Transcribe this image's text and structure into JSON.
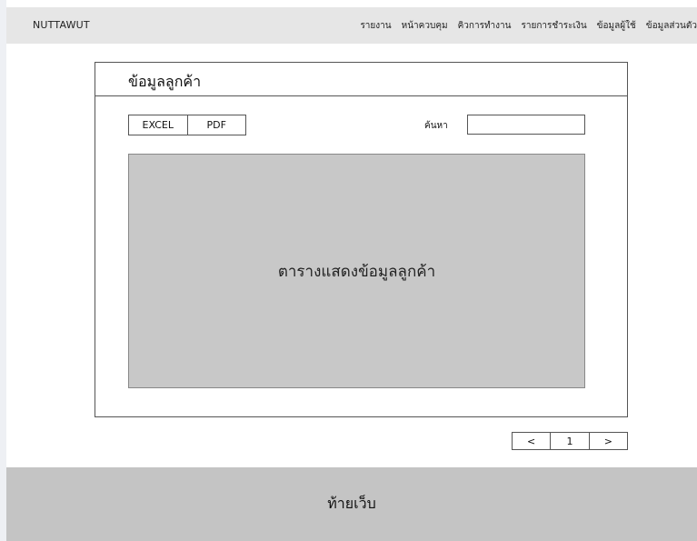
{
  "navbar": {
    "brand": "NUTTAWUT",
    "links": [
      "รายงาน",
      "หน้าควบคุม",
      "คิวการทำงาน",
      "รายการชำระเงิน",
      "ข้อมูลผู้ใช้",
      "ข้อมูลส่วนตัว"
    ]
  },
  "card": {
    "title": "ข้อมูลลูกค้า",
    "export_buttons": [
      "EXCEL",
      "PDF"
    ],
    "search_label": "ค้นหา",
    "search_value": "",
    "table_placeholder": "ตารางแสดงข้อมูลลูกค้า"
  },
  "pagination": {
    "prev": "<",
    "current_page": "1",
    "next": ">"
  },
  "footer": {
    "text": "ท้ายเว็บ"
  }
}
